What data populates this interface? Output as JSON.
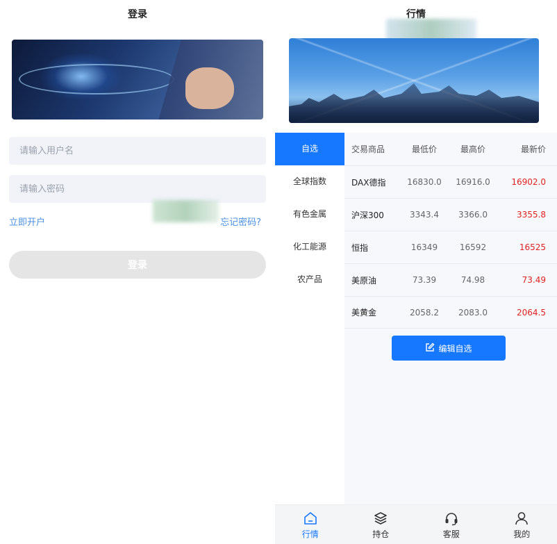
{
  "login": {
    "title": "登录",
    "username_placeholder": "请输入用户名",
    "password_placeholder": "请输入密码",
    "open_account": "立即开户",
    "forgot_password": "忘记密码?",
    "login_button": "登录"
  },
  "market": {
    "title": "行情",
    "categories": [
      {
        "label": "自选",
        "active": true
      },
      {
        "label": "全球指数"
      },
      {
        "label": "有色金属"
      },
      {
        "label": "化工能源"
      },
      {
        "label": "农产品"
      }
    ],
    "columns": [
      "交易商品",
      "最低价",
      "最高价",
      "最新价"
    ],
    "rows": [
      {
        "name": "DAX德指",
        "low": "16830.0",
        "high": "16916.0",
        "last": "16902.0"
      },
      {
        "name": "沪深300",
        "low": "3343.4",
        "high": "3366.0",
        "last": "3355.8"
      },
      {
        "name": "恒指",
        "low": "16349",
        "high": "16592",
        "last": "16525"
      },
      {
        "name": "美原油",
        "low": "73.39",
        "high": "74.98",
        "last": "73.49"
      },
      {
        "name": "美黄金",
        "low": "2058.2",
        "high": "2083.0",
        "last": "2064.5"
      }
    ],
    "edit_button": "编辑自选",
    "latest_price_color": "#e02020",
    "accent_color": "#1677ff"
  },
  "tabbar": {
    "tabs": [
      {
        "label": "行情",
        "icon": "home-icon",
        "active": true
      },
      {
        "label": "持仓",
        "icon": "layers-icon"
      },
      {
        "label": "客服",
        "icon": "headset-icon"
      },
      {
        "label": "我的",
        "icon": "user-icon"
      }
    ]
  }
}
